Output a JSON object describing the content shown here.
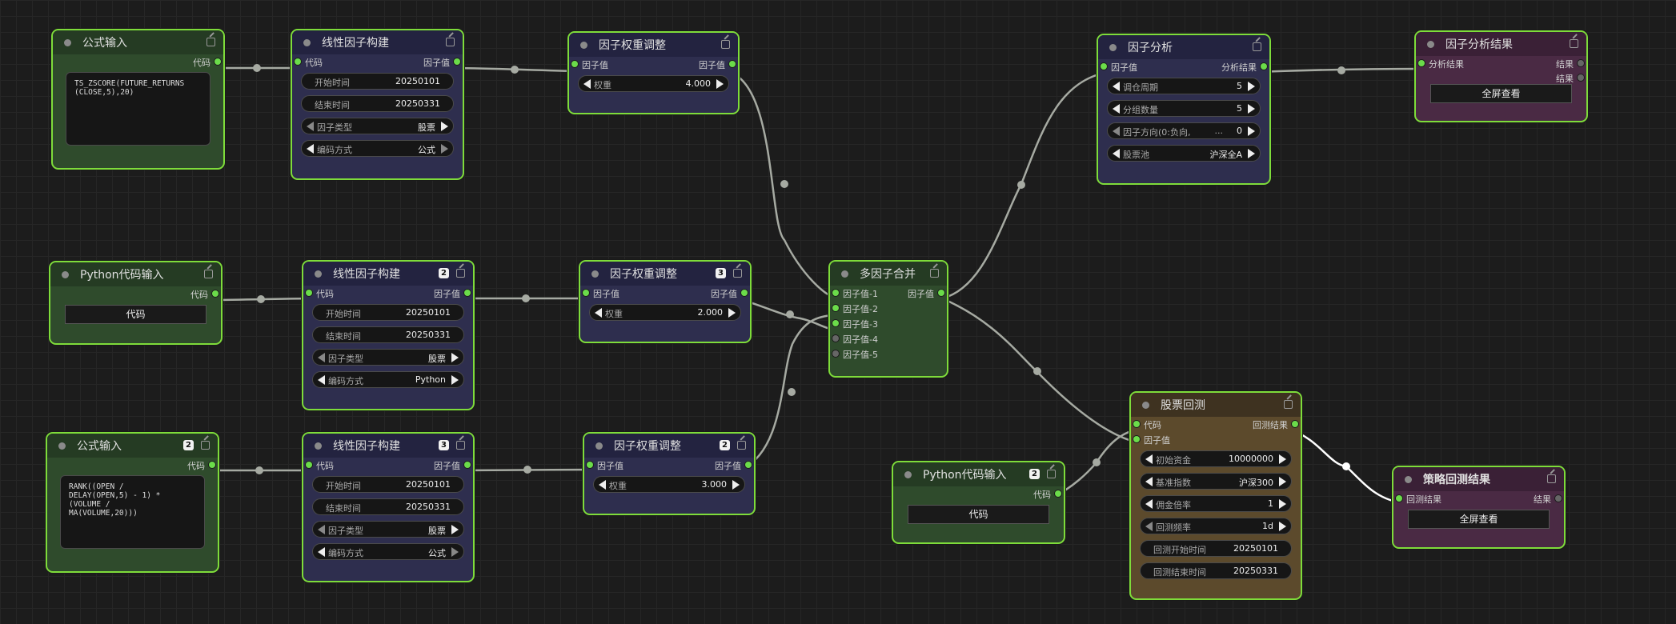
{
  "nodes": {
    "formula1": {
      "title": "公式输入",
      "out": "代码",
      "code": "TS_ZSCORE(FUTURE_RETURNS\n(CLOSE,5),20)"
    },
    "build1": {
      "title": "线性因子构建",
      "in": "代码",
      "out": "因子值",
      "start_label": "开始时间",
      "start": "20250101",
      "end_label": "结束时间",
      "end": "20250331",
      "type_label": "因子类型",
      "type": "股票",
      "enc_label": "编码方式",
      "enc": "公式"
    },
    "weight1": {
      "title": "因子权重调整",
      "in": "因子值",
      "out": "因子值",
      "w_label": "权重",
      "w": "4.000"
    },
    "python1": {
      "title": "Python代码输入",
      "out": "代码",
      "btn": "代码"
    },
    "build2": {
      "title": "线性因子构建",
      "badge": "2",
      "in": "代码",
      "out": "因子值",
      "start_label": "开始时间",
      "start": "20250101",
      "end_label": "结束时间",
      "end": "20250331",
      "type_label": "因子类型",
      "type": "股票",
      "enc_label": "编码方式",
      "enc": "Python"
    },
    "weight2": {
      "title": "因子权重调整",
      "badge": "3",
      "in": "因子值",
      "out": "因子值",
      "w_label": "权重",
      "w": "2.000"
    },
    "formula2": {
      "title": "公式输入",
      "badge": "2",
      "out": "代码",
      "code": "RANK((OPEN /\nDELAY(OPEN,5) - 1) *\n(VOLUME /\nMA(VOLUME,20)))"
    },
    "build3": {
      "title": "线性因子构建",
      "badge": "3",
      "in": "代码",
      "out": "因子值",
      "start_label": "开始时间",
      "start": "20250101",
      "end_label": "结束时间",
      "end": "20250331",
      "type_label": "因子类型",
      "type": "股票",
      "enc_label": "编码方式",
      "enc": "公式"
    },
    "weight3": {
      "title": "因子权重调整",
      "badge": "2",
      "in": "因子值",
      "out": "因子值",
      "w_label": "权重",
      "w": "3.000"
    },
    "merge": {
      "title": "多因子合并",
      "in1": "因子值-1",
      "in2": "因子值-2",
      "in3": "因子值-3",
      "in4": "因子值-4",
      "in5": "因子值-5",
      "out": "因子值"
    },
    "analysis": {
      "title": "因子分析",
      "in": "因子值",
      "out": "分析结果",
      "period_label": "调仓周期",
      "period": "5",
      "groups_label": "分组数量",
      "groups": "5",
      "dir_label": "因子方向(0:负向,",
      "dir_ellipsis": "...",
      "dir": "0",
      "pool_label": "股票池",
      "pool": "沪深全A"
    },
    "analysis_result": {
      "title": "因子分析结果",
      "in": "分析结果",
      "out1": "结果",
      "out2": "结果",
      "btn": "全屏查看"
    },
    "python2": {
      "title": "Python代码输入",
      "badge": "2",
      "out": "代码",
      "btn": "代码"
    },
    "backtest": {
      "title": "股票回测",
      "in1": "代码",
      "in2": "因子值",
      "out": "回测结果",
      "capital_label": "初始资金",
      "capital": "10000000",
      "bench_label": "基准指数",
      "bench": "沪深300",
      "comm_label": "佣金倍率",
      "comm": "1",
      "freq_label": "回测频率",
      "freq": "1d",
      "bstart_label": "回测开始时间",
      "bstart": "20250101",
      "bend_label": "回测结束时间",
      "bend": "20250331"
    },
    "strategy_result": {
      "title": "策略回测结果",
      "in": "回测结果",
      "out": "结果",
      "btn": "全屏查看"
    }
  }
}
